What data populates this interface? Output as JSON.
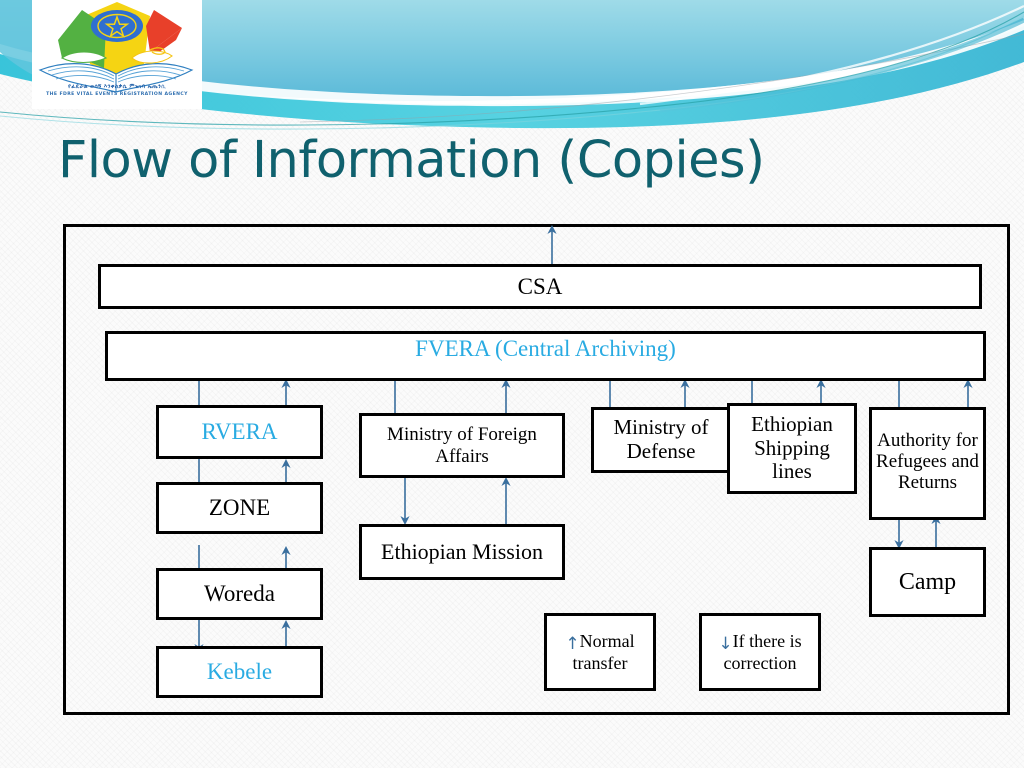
{
  "slide": {
    "title": "Flow of Information (Copies)",
    "title_color": "#10616e",
    "accent_color": "#29ABE2",
    "arrow_color": "#3a6f9e"
  },
  "logo": {
    "name": "fdre-vital-events-registration-agency-logo",
    "caption_amharic": "የፈዴራል ወሳኝ እንቀስቃሴ ምዝገባ ኤጤንሲ",
    "caption_english": "THE FDRE VITAL EVENTS REGISTRATION AGENCY"
  },
  "diagram": {
    "nodes": [
      {
        "id": "csa",
        "label": "CSA",
        "color": "black"
      },
      {
        "id": "fvera",
        "label": "FVERA (Central Archiving)",
        "color": "cyan"
      },
      {
        "id": "rvera",
        "label": "RVERA",
        "color": "cyan"
      },
      {
        "id": "zone",
        "label": "ZONE",
        "color": "black"
      },
      {
        "id": "woreda",
        "label": "Woreda",
        "color": "black"
      },
      {
        "id": "kebele",
        "label": "Kebele",
        "color": "cyan"
      },
      {
        "id": "mofa",
        "label": "Ministry  of Foreign Affairs",
        "color": "black"
      },
      {
        "id": "mission",
        "label": "Ethiopian Mission",
        "color": "black"
      },
      {
        "id": "mod",
        "label": "Ministry of Defense",
        "color": "black"
      },
      {
        "id": "shipping",
        "label": "Ethiopian Shipping lines",
        "color": "black"
      },
      {
        "id": "refugees",
        "label": "Authority for Refugees and Returns",
        "color": "black"
      },
      {
        "id": "camp",
        "label": "Camp",
        "color": "black"
      }
    ],
    "legend": [
      {
        "id": "normal-transfer",
        "glyph": "↑",
        "line1": "Normal",
        "line2": "transfer"
      },
      {
        "id": "correction",
        "glyph": "↓",
        "line1": "If there is",
        "line2": "correction"
      }
    ]
  }
}
